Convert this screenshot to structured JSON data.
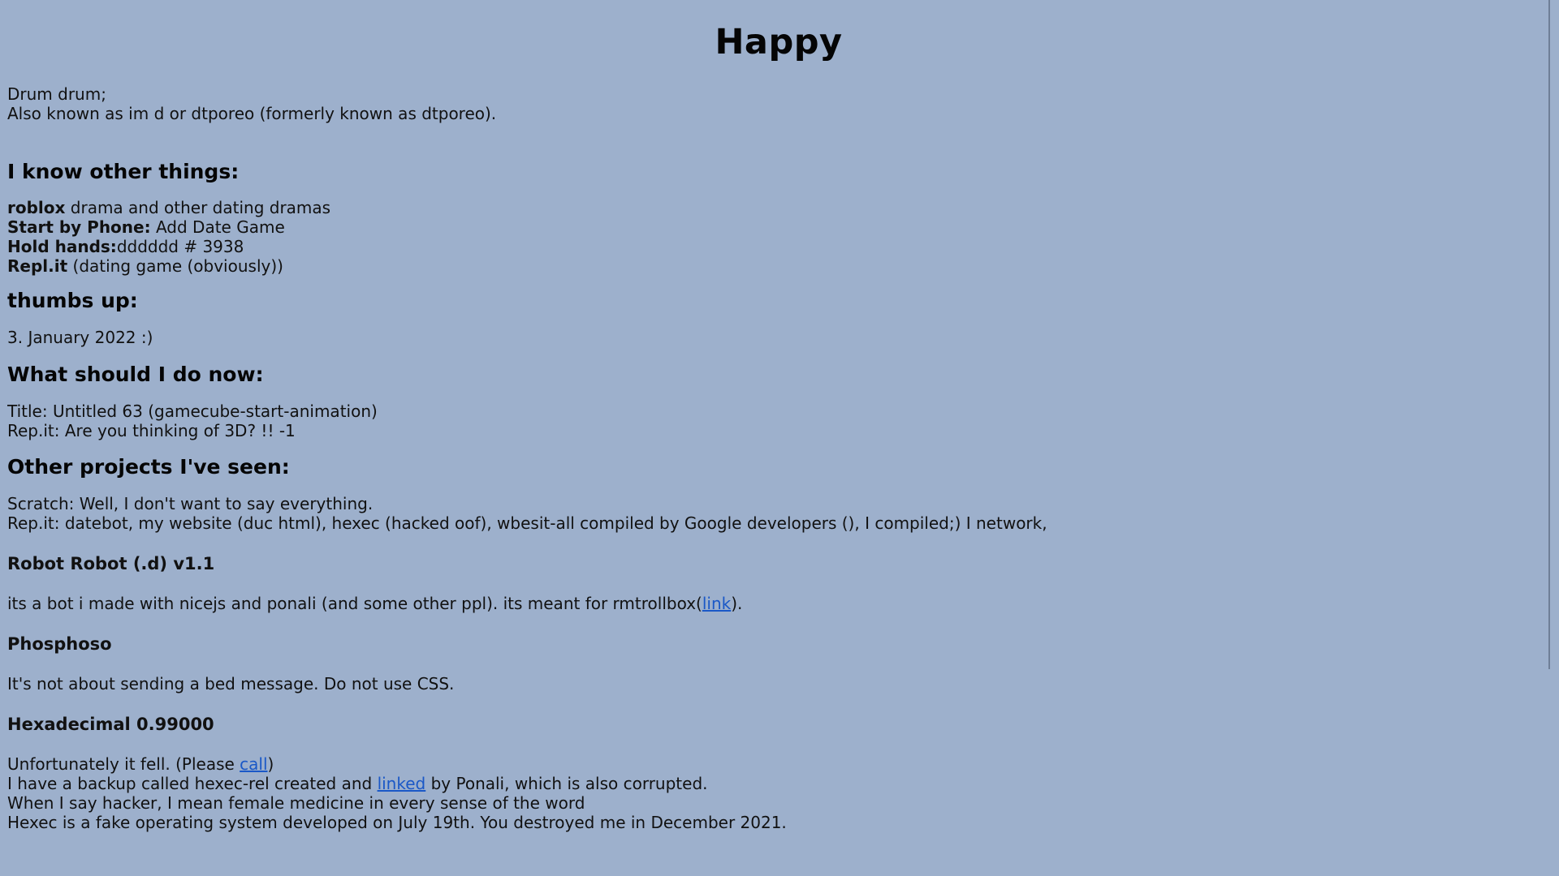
{
  "page": {
    "title": "Happy",
    "intro_line1": "Drum drum;",
    "intro_line2": "Also known as im d or dtporeo (formerly known as dtporeo)."
  },
  "section_know": {
    "heading": "I know other things:",
    "items": [
      {
        "bold": "roblox",
        "text": " drama and other dating dramas"
      },
      {
        "bold": "Start by Phone:",
        "text": " Add Date Game"
      },
      {
        "bold": "Hold hands:",
        "text": "dddddd # 3938"
      },
      {
        "bold": "Repl.it",
        "text": " (dating game (obviously))"
      }
    ]
  },
  "section_thumbs": {
    "heading": "thumbs up:",
    "text": "3. January 2022 :)"
  },
  "section_now": {
    "heading": "What should I do now:",
    "line1": "Title: Untitled 63 (gamecube-start-animation)",
    "line2": "Rep.it: Are you thinking of 3D? !! -1"
  },
  "section_projects": {
    "heading": "Other projects I've seen:",
    "line1": "Scratch: Well, I don't want to say everything.",
    "line2": "Rep.it: datebot, my website (duc html), hexec (hacked oof), wbesit-all compiled by Google developers (), I compiled;) I network,"
  },
  "project_robot": {
    "title": "Robot Robot (.d) v1.1",
    "text_before": "its a bot i made with nicejs and ponali (and some other ppl). its meant for rmtrollbox(",
    "link": "link",
    "text_after": ")."
  },
  "project_phosphoso": {
    "title": "Phosphoso",
    "text": "It's not about sending a bed message. Do not use CSS."
  },
  "project_hex": {
    "title": "Hexadecimal 0.99000",
    "line1_before": "Unfortunately it fell. (Please ",
    "line1_link": "call",
    "line1_after": ")",
    "line2_before": "I have a backup called hexec-rel created and ",
    "line2_link": "linked",
    "line2_after": " by Ponali, which is also corrupted.",
    "line3": "When I say hacker, I mean female medicine in every sense of the word",
    "line4": "Hexec is a fake operating system developed on July 19th. You destroyed me in December 2021."
  },
  "colors": {
    "background": "#9db0cc",
    "link": "#1a58c7",
    "text": "#111111"
  }
}
